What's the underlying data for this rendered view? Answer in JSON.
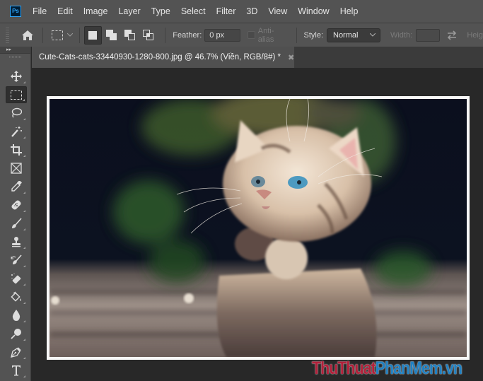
{
  "app": {
    "logo_text": "Ps",
    "brand_color": "#31a8ff"
  },
  "menu": [
    "File",
    "Edit",
    "Image",
    "Layer",
    "Type",
    "Select",
    "Filter",
    "3D",
    "View",
    "Window",
    "Help"
  ],
  "options_bar": {
    "feather_label": "Feather:",
    "feather_value": "0 px",
    "anti_alias_label": "Anti-alias",
    "anti_alias_checked": false,
    "style_label": "Style:",
    "style_value": "Normal",
    "width_label": "Width:",
    "width_value": "",
    "height_label": "Heig"
  },
  "toolbar": {
    "collapse_label": "▸▸",
    "tools": [
      {
        "name": "move-tool",
        "icon": "move-icon",
        "active": false
      },
      {
        "name": "rectangular-marquee-tool",
        "icon": "marquee-icon",
        "active": true
      },
      {
        "name": "lasso-tool",
        "icon": "lasso-icon",
        "active": false
      },
      {
        "name": "magic-wand-tool",
        "icon": "magic-wand-icon",
        "active": false
      },
      {
        "name": "crop-tool",
        "icon": "crop-icon",
        "active": false
      },
      {
        "name": "frame-tool",
        "icon": "frame-icon",
        "active": false
      },
      {
        "name": "eyedropper-tool",
        "icon": "eyedropper-icon",
        "active": false
      },
      {
        "name": "spot-healing-tool",
        "icon": "bandage-icon",
        "active": false
      },
      {
        "name": "brush-tool",
        "icon": "brush-icon",
        "active": false
      },
      {
        "name": "clone-stamp-tool",
        "icon": "stamp-icon",
        "active": false
      },
      {
        "name": "history-brush-tool",
        "icon": "history-brush-icon",
        "active": false
      },
      {
        "name": "eraser-tool",
        "icon": "eraser-icon",
        "active": false
      },
      {
        "name": "paint-bucket-tool",
        "icon": "paint-bucket-icon",
        "active": false
      },
      {
        "name": "blur-tool",
        "icon": "blur-drop-icon",
        "active": false
      },
      {
        "name": "dodge-tool",
        "icon": "dodge-icon",
        "active": false
      },
      {
        "name": "pen-tool",
        "icon": "pen-icon",
        "active": false
      },
      {
        "name": "type-tool",
        "icon": "type-icon",
        "active": false
      }
    ]
  },
  "document": {
    "tab_title": "Cute-Cats-cats-33440930-1280-800.jpg @ 46.7% (Viền, RGB/8#) *",
    "close_glyph": "✖",
    "zoom": "46.7%",
    "layer": "Viền",
    "color_mode": "RGB/8#"
  },
  "watermark": {
    "part1": "ThuThuat",
    "part2": "PhanMem",
    "part3": ".vn",
    "color_red": "#b2203a",
    "color_blue": "#2081c3"
  }
}
